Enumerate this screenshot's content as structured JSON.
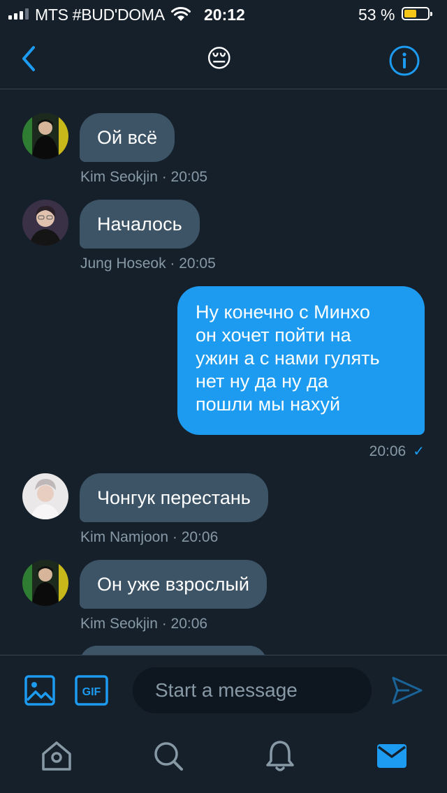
{
  "status_bar": {
    "carrier": "MTS #BUD'DOMA",
    "time": "20:12",
    "battery_percent": "53 %",
    "battery_level": 0.53,
    "icons": [
      "signal-icon",
      "wifi-icon",
      "battery-icon"
    ]
  },
  "header": {
    "title_emoji": "😔",
    "icons": [
      "back-arrow-icon",
      "info-icon"
    ]
  },
  "messages": [
    {
      "direction": "in",
      "text": "Ой всё",
      "sender": "Kim Seokjin",
      "time": "20:05",
      "meta": "Kim Seokjin · 20:05"
    },
    {
      "direction": "in",
      "text": "Началось",
      "sender": "Jung Hoseok",
      "time": "20:05",
      "meta": "Jung Hoseok · 20:05"
    },
    {
      "direction": "out",
      "lines": [
        "Ну конечно с Минхо",
        "он хочет пойти на",
        "ужин а с нами гулять",
        "нет ну да ну да",
        "пошли мы нахуй"
      ],
      "time": "20:06",
      "status": "✓"
    },
    {
      "direction": "in",
      "text": "Чонгук перестань",
      "sender": "Kim Namjoon",
      "time": "20:06",
      "meta": "Kim Namjoon · 20:06"
    },
    {
      "direction": "in",
      "text": "Он уже взрослый",
      "sender": "Kim Seokjin",
      "time": "20:06",
      "meta": "Kim Seokjin · 20:06"
    }
  ],
  "composer": {
    "placeholder": "Start a message",
    "gif_label": "GIF",
    "icons": [
      "image-icon",
      "gif-icon",
      "send-icon"
    ]
  },
  "tab_bar": {
    "icons": [
      "home-icon",
      "search-icon",
      "notifications-bell-icon",
      "messages-envelope-icon"
    ],
    "active": "messages-envelope-icon"
  },
  "colors": {
    "background": "#15202b",
    "accent": "#1d9bf0",
    "incoming_bubble": "#3d5466",
    "meta_text": "#8899a6",
    "divider": "#38444d",
    "battery_fill": "#f5c518"
  }
}
